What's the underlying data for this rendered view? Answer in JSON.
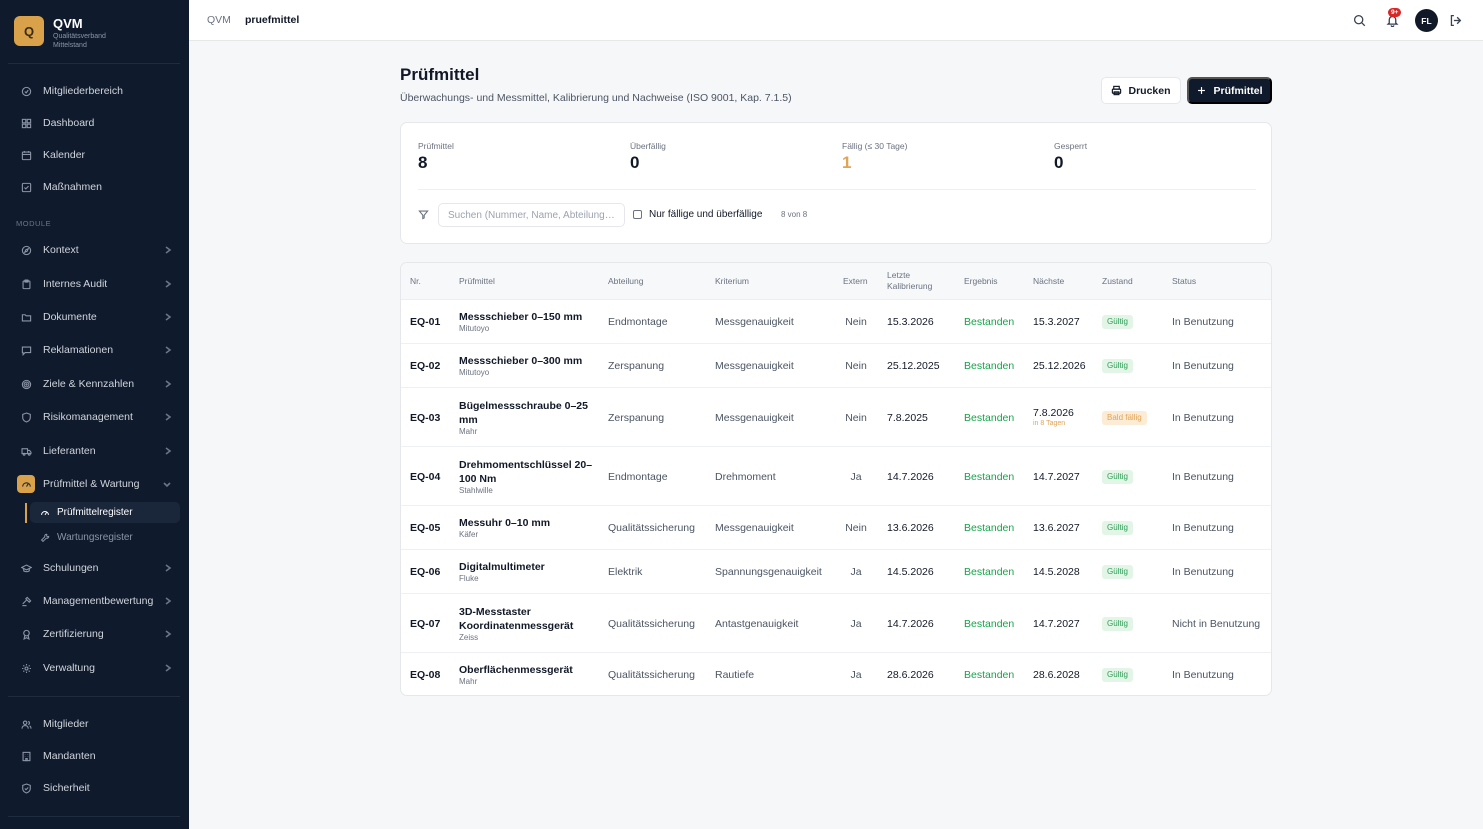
{
  "brand": {
    "logo_letter": "Q",
    "name": "QVM",
    "subtitle": "Qualitätsverband Mittelstand"
  },
  "sidebar": {
    "top_items": [
      {
        "label": "Mitgliederbereich",
        "icon": "circle-check-icon"
      },
      {
        "label": "Dashboard",
        "icon": "grid-icon"
      },
      {
        "label": "Kalender",
        "icon": "calendar-icon"
      },
      {
        "label": "Maßnahmen",
        "icon": "checkbox-icon"
      }
    ],
    "section_label": "MODULE",
    "module_items": [
      {
        "label": "Kontext",
        "icon": "compass-icon"
      },
      {
        "label": "Internes Audit",
        "icon": "clipboard-icon"
      },
      {
        "label": "Dokumente",
        "icon": "folder-icon"
      },
      {
        "label": "Reklamationen",
        "icon": "message-icon"
      },
      {
        "label": "Ziele & Kennzahlen",
        "icon": "target-icon"
      },
      {
        "label": "Risikomanagement",
        "icon": "shield-icon"
      },
      {
        "label": "Lieferanten",
        "icon": "truck-icon"
      },
      {
        "label": "Prüfmittel & Wartung",
        "icon": "gauge-icon",
        "active": true
      },
      {
        "label": "Schulungen",
        "icon": "graduation-icon"
      },
      {
        "label": "Managementbewertung",
        "icon": "gavel-icon"
      },
      {
        "label": "Zertifizierung",
        "icon": "award-icon"
      },
      {
        "label": "Verwaltung",
        "icon": "gear-icon"
      }
    ],
    "sub_items": [
      {
        "label": "Prüfmittelregister",
        "icon": "gauge-icon",
        "active": true
      },
      {
        "label": "Wartungsregister",
        "icon": "wrench-icon"
      }
    ],
    "bottom_items": [
      {
        "label": "Mitglieder",
        "icon": "users-icon"
      },
      {
        "label": "Mandanten",
        "icon": "building-icon"
      },
      {
        "label": "Sicherheit",
        "icon": "shield-check-icon"
      }
    ]
  },
  "topbar": {
    "breadcrumb_root": "QVM",
    "breadcrumb_current": "pruefmittel",
    "notification_badge": "9+",
    "avatar_initials": "FL"
  },
  "page": {
    "title": "Prüfmittel",
    "subtitle": "Überwachungs- und Messmittel, Kalibrierung und Nachweise (ISO 9001, Kap. 7.1.5)",
    "print_button": "Drucken",
    "add_button": "Prüfmittel"
  },
  "stats": [
    {
      "label": "Prüfmittel",
      "value": "8"
    },
    {
      "label": "Überfällig",
      "value": "0"
    },
    {
      "label": "Fällig (≤ 30 Tage)",
      "value": "1",
      "color": "#e0a458"
    },
    {
      "label": "Gesperrt",
      "value": "0"
    }
  ],
  "filter": {
    "search_placeholder": "Suchen (Nummer, Name, Abteilung…)",
    "checkbox_label": "Nur fällige und überfällige",
    "count_text": "8 von 8"
  },
  "table": {
    "headers": {
      "nr": "Nr.",
      "name": "Prüfmittel",
      "abteilung": "Abteilung",
      "kriterium": "Kriterium",
      "extern": "Extern",
      "letzte_1": "Letzte",
      "letzte_2": "Kalibrierung",
      "ergebnis": "Ergebnis",
      "naechste": "Nächste",
      "zustand": "Zustand",
      "status": "Status"
    },
    "rows": [
      {
        "nr": "EQ-01",
        "name": "Messschieber 0–150 mm",
        "maker": "Mitutoyo",
        "abteilung": "Endmontage",
        "kriterium": "Messgenauigkeit",
        "extern": "Nein",
        "letzte": "15.3.2026",
        "ergebnis": "Bestanden",
        "naechste": "15.3.2027",
        "naechste_hint": "",
        "zustand": "Gültig",
        "zustand_type": "ok",
        "status": "In Benutzung"
      },
      {
        "nr": "EQ-02",
        "name": "Messschieber 0–300 mm",
        "maker": "Mitutoyo",
        "abteilung": "Zerspanung",
        "kriterium": "Messgenauigkeit",
        "extern": "Nein",
        "letzte": "25.12.2025",
        "ergebnis": "Bestanden",
        "naechste": "25.12.2026",
        "naechste_hint": "",
        "zustand": "Gültig",
        "zustand_type": "ok",
        "status": "In Benutzung"
      },
      {
        "nr": "EQ-03",
        "name": "Bügelmessschraube 0–25 mm",
        "maker": "Mahr",
        "abteilung": "Zerspanung",
        "kriterium": "Messgenauigkeit",
        "extern": "Nein",
        "letzte": "7.8.2025",
        "ergebnis": "Bestanden",
        "naechste": "7.8.2026",
        "naechste_hint": "in 8 Tagen",
        "zustand": "Bald fällig",
        "zustand_type": "warn",
        "status": "In Benutzung"
      },
      {
        "nr": "EQ-04",
        "name": "Drehmomentschlüssel 20–100 Nm",
        "maker": "Stahlwille",
        "abteilung": "Endmontage",
        "kriterium": "Drehmoment",
        "extern": "Ja",
        "letzte": "14.7.2026",
        "ergebnis": "Bestanden",
        "naechste": "14.7.2027",
        "naechste_hint": "",
        "zustand": "Gültig",
        "zustand_type": "ok",
        "status": "In Benutzung"
      },
      {
        "nr": "EQ-05",
        "name": "Messuhr 0–10 mm",
        "maker": "Käfer",
        "abteilung": "Qualitätssicherung",
        "kriterium": "Messgenauigkeit",
        "extern": "Nein",
        "letzte": "13.6.2026",
        "ergebnis": "Bestanden",
        "naechste": "13.6.2027",
        "naechste_hint": "",
        "zustand": "Gültig",
        "zustand_type": "ok",
        "status": "In Benutzung"
      },
      {
        "nr": "EQ-06",
        "name": "Digitalmultimeter",
        "maker": "Fluke",
        "abteilung": "Elektrik",
        "kriterium": "Spannungsgenauigkeit",
        "extern": "Ja",
        "letzte": "14.5.2026",
        "ergebnis": "Bestanden",
        "naechste": "14.5.2028",
        "naechste_hint": "",
        "zustand": "Gültig",
        "zustand_type": "ok",
        "status": "In Benutzung"
      },
      {
        "nr": "EQ-07",
        "name": "3D-Messtaster Koordinatenmessgerät",
        "maker": "Zeiss",
        "abteilung": "Qualitätssicherung",
        "kriterium": "Antastgenauigkeit",
        "extern": "Ja",
        "letzte": "14.7.2026",
        "ergebnis": "Bestanden",
        "naechste": "14.7.2027",
        "naechste_hint": "",
        "zustand": "Gültig",
        "zustand_type": "ok",
        "status": "Nicht in Benutzung"
      },
      {
        "nr": "EQ-08",
        "name": "Oberflächenmessgerät",
        "maker": "Mahr",
        "abteilung": "Qualitätssicherung",
        "kriterium": "Rautiefe",
        "extern": "Ja",
        "letzte": "28.6.2026",
        "ergebnis": "Bestanden",
        "naechste": "28.6.2028",
        "naechste_hint": "",
        "zustand": "Gültig",
        "zustand_type": "ok",
        "status": "In Benutzung"
      }
    ]
  }
}
